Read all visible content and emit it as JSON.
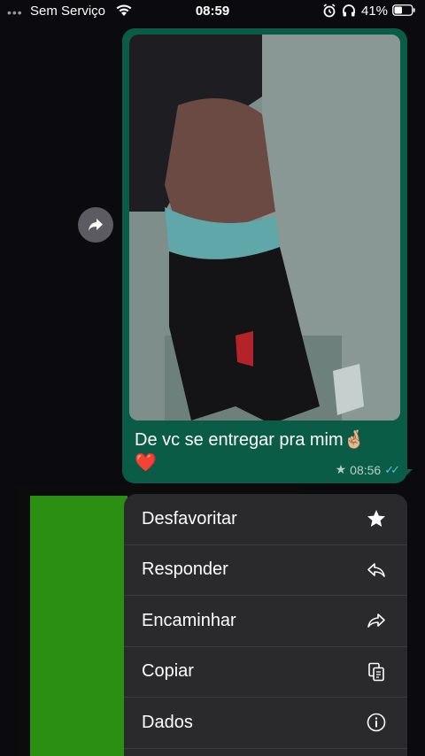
{
  "status_bar": {
    "dots": "•••",
    "carrier": "Sem Serviço",
    "time": "08:59",
    "battery": "41%"
  },
  "message": {
    "caption": "De vc se entregar pra mim🤞🏼",
    "caption_heart": "❤️",
    "star": "★",
    "time": "08:56",
    "ticks": "✓✓"
  },
  "colors": {
    "bubble": "#0b5c46",
    "menu_bg": "#2a2a2c",
    "green_bar": "#2a8f12",
    "tick": "#53bdeb"
  },
  "context_menu": {
    "items": [
      {
        "label": "Desfavoritar",
        "icon": "star-filled-icon"
      },
      {
        "label": "Responder",
        "icon": "reply-icon"
      },
      {
        "label": "Encaminhar",
        "icon": "forward-icon"
      },
      {
        "label": "Copiar",
        "icon": "copy-icon"
      },
      {
        "label": "Dados",
        "icon": "info-icon"
      }
    ]
  }
}
